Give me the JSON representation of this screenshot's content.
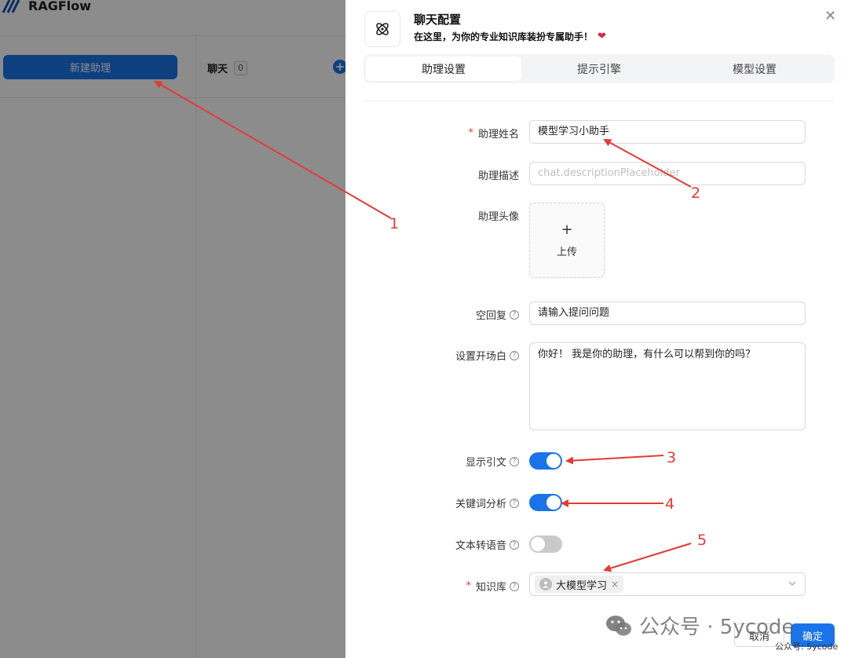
{
  "app": {
    "name": "RAGFlow",
    "new_assistant_button": "新建助理",
    "chat_label": "聊天",
    "chat_count": "0"
  },
  "drawer": {
    "title": "聊天配置",
    "subtitle": "在这里，为你的专业知识库装扮专属助手！",
    "tabs": [
      {
        "label": "助理设置",
        "active": true
      },
      {
        "label": "提示引擎",
        "active": false
      },
      {
        "label": "模型设置",
        "active": false
      }
    ],
    "form": {
      "name": {
        "label": "助理姓名",
        "value": "模型学习小助手",
        "required": true
      },
      "description": {
        "label": "助理描述",
        "placeholder": "chat.descriptionPlaceholder"
      },
      "avatar": {
        "label": "助理头像",
        "upload_text": "上传"
      },
      "empty_reply": {
        "label": "空回复",
        "value": "请输入提问问题"
      },
      "opener": {
        "label": "设置开场白",
        "value": "你好！ 我是你的助理，有什么可以帮到你的吗？"
      },
      "show_quote": {
        "label": "显示引文",
        "on": true
      },
      "keyword_analysis": {
        "label": "关键词分析",
        "on": true
      },
      "tts": {
        "label": "文本转语音",
        "on": false
      },
      "knowledge_base": {
        "label": "知识库",
        "required": true,
        "selected": [
          "大模型学习"
        ]
      }
    },
    "footer": {
      "cancel": "取消",
      "ok": "确定"
    }
  },
  "annotations": {
    "color": "#e53935",
    "labels": [
      "1",
      "2",
      "3",
      "4",
      "5"
    ]
  },
  "watermark": {
    "text": "公众号 · 5ycode",
    "small": "公众号: 5ycode"
  },
  "colors": {
    "primary": "#1a73e8",
    "annotation": "#e53935"
  }
}
